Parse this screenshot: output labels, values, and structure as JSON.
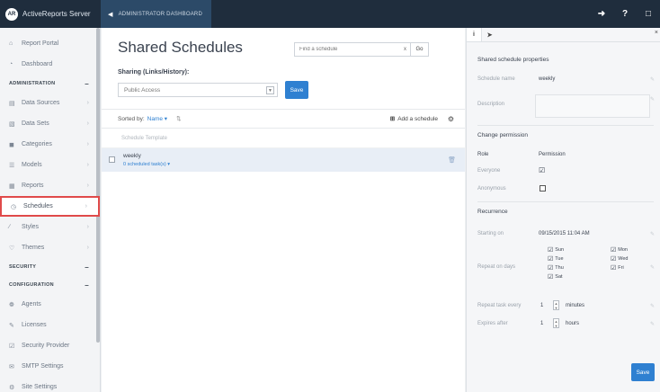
{
  "topbar": {
    "logo_text": "AR",
    "brand": "ActiveReports Server",
    "admin_tab": "ADMINISTRATOR DASHBOARD",
    "icons": [
      "login-icon",
      "help-icon",
      "user-icon"
    ],
    "help_glyph": "?"
  },
  "sidebar": {
    "items": [
      {
        "label": "Report Portal",
        "icon": "home-icon"
      },
      {
        "label": "Dashboard",
        "icon": "dashboard-icon"
      }
    ],
    "sections": {
      "administration": "ADMINISTRATION",
      "security": "SECURITY",
      "configuration": "CONFIGURATION"
    },
    "admin_items": [
      {
        "label": "Data Sources",
        "icon": "database-icon"
      },
      {
        "label": "Data Sets",
        "icon": "dataset-icon"
      },
      {
        "label": "Categories",
        "icon": "tag-icon"
      },
      {
        "label": "Models",
        "icon": "model-icon"
      },
      {
        "label": "Reports",
        "icon": "report-icon"
      },
      {
        "label": "Schedules",
        "icon": "clock-icon"
      },
      {
        "label": "Styles",
        "icon": "brush-icon"
      },
      {
        "label": "Themes",
        "icon": "theme-icon"
      }
    ],
    "config_items": [
      {
        "label": "Agents",
        "icon": "agent-icon"
      },
      {
        "label": "Licenses",
        "icon": "license-icon"
      },
      {
        "label": "Security Provider",
        "icon": "shield-icon"
      },
      {
        "label": "SMTP Settings",
        "icon": "mail-icon"
      },
      {
        "label": "Site Settings",
        "icon": "settings-icon"
      }
    ],
    "active": "Schedules"
  },
  "main": {
    "title": "Shared Schedules",
    "search_placeholder": "Find a schedule",
    "clear_label": "x",
    "go_label": "Go",
    "sharing_label": "Sharing (Links/History):",
    "sharing_value": "Public Access",
    "save_label": "Save",
    "sorted_by_label": "Sorted by:",
    "sorted_by_value": "Name",
    "add_schedule_label": "Add a schedule",
    "template_label": "Schedule Template",
    "schedules": [
      {
        "name": "weekly",
        "link": "0 scheduled task(s)"
      }
    ]
  },
  "panel": {
    "tab_info": "i",
    "heading": "Shared schedule properties",
    "schedule_name_label": "Schedule name",
    "schedule_name_value": "weekly",
    "description_label": "Description",
    "change_permission_label": "Change permission",
    "role_header": "Role",
    "permission_header": "Permission",
    "roles": [
      {
        "name": "Everyone",
        "checked": true
      },
      {
        "name": "Anonymous",
        "checked": false
      }
    ],
    "recurrence_label": "Recurrence",
    "starting_on_label": "Starting on",
    "starting_on_value": "09/15/2015 11:04 AM",
    "repeat_on_days_label": "Repeat on days",
    "days": [
      {
        "name": "Sun",
        "checked": true
      },
      {
        "name": "Mon",
        "checked": true
      },
      {
        "name": "Tue",
        "checked": true
      },
      {
        "name": "Wed",
        "checked": true
      },
      {
        "name": "Thu",
        "checked": true
      },
      {
        "name": "Fri",
        "checked": true
      },
      {
        "name": "Sat",
        "checked": true
      }
    ],
    "repeat_task_every_label": "Repeat task every",
    "repeat_task_every_value": "1",
    "repeat_task_every_unit": "minutes",
    "expires_after_label": "Expires after",
    "expires_after_value": "1",
    "expires_after_unit": "hours",
    "save_label": "Save"
  }
}
